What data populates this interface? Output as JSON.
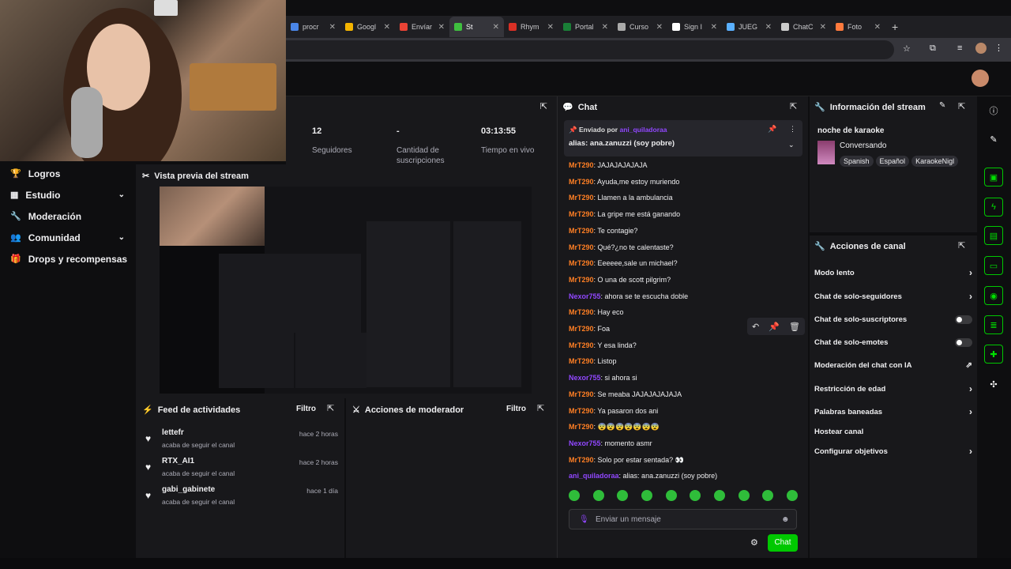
{
  "browser": {
    "tabs": [
      {
        "label": "procr",
        "color": "#4a86e8"
      },
      {
        "label": "Googl",
        "color": "#f4b400"
      },
      {
        "label": "Envíar",
        "color": "#ea4335"
      },
      {
        "label": "St",
        "color": "#3fbf3f",
        "active": true
      },
      {
        "label": "Rhym",
        "color": "#d93025"
      },
      {
        "label": "Portal",
        "color": "#1a7f37"
      },
      {
        "label": "Curso",
        "color": "#aaaaaa"
      },
      {
        "label": "Sign I",
        "color": "#ffffff"
      },
      {
        "label": "JUEG",
        "color": "#5ab0ff"
      },
      {
        "label": "ChatC",
        "color": "#cccccc"
      },
      {
        "label": "Foto",
        "color": "#ff7a3d"
      }
    ]
  },
  "stats": {
    "followers": {
      "value": "12",
      "label": "Seguidores"
    },
    "subs": {
      "value": "-",
      "label": "Cantidad de suscripciones"
    },
    "live": {
      "value": "03:13:55",
      "label": "Tiempo en vivo"
    }
  },
  "sidebar": {
    "items": [
      {
        "label": "Logros",
        "icon": "trophy-icon"
      },
      {
        "label": "Estudio",
        "icon": "studio-icon",
        "chevron": true
      },
      {
        "label": "Moderación",
        "icon": "wrench-icon"
      },
      {
        "label": "Comunidad",
        "icon": "people-icon",
        "chevron": true
      },
      {
        "label": "Drops y recompensas",
        "icon": "gift-icon"
      }
    ]
  },
  "preview": {
    "title": "Vista previa del stream"
  },
  "feed": {
    "title": "Feed de actividades",
    "filter": "Filtro",
    "items": [
      {
        "name": "lettefr",
        "sub": "acaba de seguir el canal",
        "time": "hace 2 horas"
      },
      {
        "name": "RTX_AI1",
        "sub": "acaba de seguir el canal",
        "time": "hace 2 horas"
      },
      {
        "name": "gabi_gabinete",
        "sub": "acaba de seguir el canal",
        "time": "hace 1 día"
      }
    ]
  },
  "modactions": {
    "title": "Acciones de moderador",
    "filter": "Filtro"
  },
  "chat": {
    "title": "Chat",
    "pinned": {
      "by_label": "Enviado por",
      "by_user": "ani_quiladoraa",
      "text": "alias: ana.zanuzzi (soy pobre)"
    },
    "messages": [
      {
        "user": "MrT290",
        "text": "JAJAJAJAJAJA",
        "color": "#ff7f24"
      },
      {
        "user": "MrT290",
        "text": "Ayuda,me estoy muriendo",
        "color": "#ff7f24"
      },
      {
        "user": "MrT290",
        "text": "Llamen a la ambulancia",
        "color": "#ff7f24"
      },
      {
        "user": "MrT290",
        "text": "La gripe me está ganando",
        "color": "#ff7f24"
      },
      {
        "user": "MrT290",
        "text": "Te contagie?",
        "color": "#ff7f24"
      },
      {
        "user": "MrT290",
        "text": "Qué?¿no te calentaste?",
        "color": "#ff7f24"
      },
      {
        "user": "MrT290",
        "text": "Eeeeee,sale un michael?",
        "color": "#ff7f24"
      },
      {
        "user": "MrT290",
        "text": "O una de scott pilgrim?",
        "color": "#ff7f24"
      },
      {
        "user": "Nexor755",
        "text": "ahora se te escucha doble",
        "color": "#9147ff"
      },
      {
        "user": "MrT290",
        "text": "Hay eco",
        "color": "#ff7f24"
      },
      {
        "user": "MrT290",
        "text": "Foa",
        "color": "#ff7f24"
      },
      {
        "user": "MrT290",
        "text": "Y esa linda?",
        "color": "#ff7f24"
      },
      {
        "user": "MrT290",
        "text": "Listop",
        "color": "#ff7f24"
      },
      {
        "user": "Nexor755",
        "text": "si ahora si",
        "color": "#9147ff"
      },
      {
        "user": "MrT290",
        "text": "Se meaba JAJAJAJAJAJA",
        "color": "#ff7f24"
      },
      {
        "user": "MrT290",
        "text": "Ya pasaron dos ani",
        "color": "#ff7f24"
      },
      {
        "user": "MrT290",
        "text": "😨😨😨😨😨😨😨",
        "color": "#ff7f24"
      },
      {
        "user": "Nexor755",
        "text": "momento asmr",
        "color": "#9147ff"
      },
      {
        "user": "MrT290",
        "text": "Solo por estar sentada? 👀",
        "color": "#ff7f24"
      },
      {
        "user": "ani_quiladoraa",
        "text": "alias: ana.zanuzzi (soy pobre)",
        "color": "#9147ff"
      }
    ],
    "input_placeholder": "Enviar un mensaje",
    "send": "Chat"
  },
  "info": {
    "title": "Información del stream",
    "stream_title": "noche de karaoke",
    "category": "Conversando",
    "tags": [
      "Spanish",
      "Español",
      "KaraokeNigl"
    ]
  },
  "actions": {
    "title": "Acciones de canal",
    "items": [
      {
        "label": "Modo lento",
        "kind": "chevron"
      },
      {
        "label": "Chat de solo-seguidores",
        "kind": "chevron"
      },
      {
        "label": "Chat de solo-suscriptores",
        "kind": "toggle"
      },
      {
        "label": "Chat de solo-emotes",
        "kind": "toggle"
      },
      {
        "label": "Moderación del chat con IA",
        "kind": "external"
      },
      {
        "label": "Restricción de edad",
        "kind": "chevron"
      },
      {
        "label": "Palabras baneadas",
        "kind": "chevron"
      },
      {
        "label": "Hostear canal",
        "kind": "none"
      },
      {
        "label": "Configurar objetivos",
        "kind": "chevron"
      }
    ]
  },
  "colors": {
    "accent": "#00c800",
    "orange_user": "#ff7f24",
    "purple_user": "#9147ff"
  }
}
